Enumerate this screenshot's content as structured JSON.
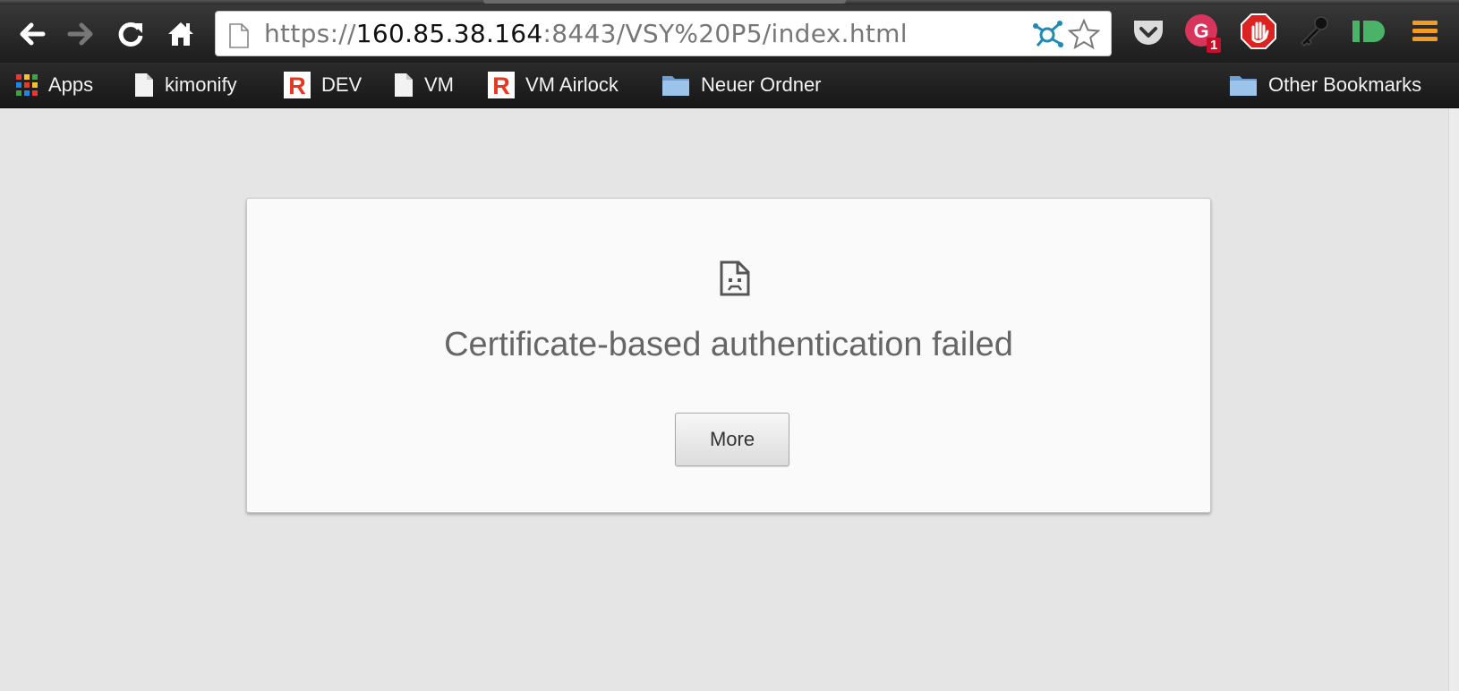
{
  "browser": {
    "address_bar": {
      "scheme": "https://",
      "host": "160.85.38.164",
      "rest": ":8443/VSY%20P5/index.html"
    },
    "extensions": [
      {
        "name": "pocket-icon"
      },
      {
        "name": "grammarly-icon",
        "badge": "1"
      },
      {
        "name": "adblock-icon"
      },
      {
        "name": "lastpass-key-icon"
      },
      {
        "name": "pushbullet-icon"
      },
      {
        "name": "menu-icon"
      }
    ]
  },
  "bookmarks_bar": {
    "items": [
      {
        "label": "Apps",
        "icon": "apps-grid-icon"
      },
      {
        "label": "kimonify",
        "icon": "page-icon"
      },
      {
        "label": "DEV",
        "icon": "redmine-icon"
      },
      {
        "label": "VM",
        "icon": "page-icon"
      },
      {
        "label": "VM Airlock",
        "icon": "redmine-icon"
      },
      {
        "label": "Neuer Ordner",
        "icon": "folder-icon"
      }
    ],
    "other": {
      "label": "Other Bookmarks",
      "icon": "folder-icon"
    }
  },
  "error_page": {
    "icon": "sad-page-icon",
    "title": "Certificate-based authentication failed",
    "more_button": "More"
  }
}
